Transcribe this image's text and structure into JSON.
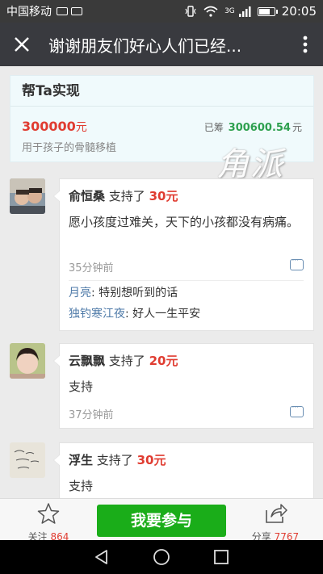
{
  "status": {
    "carrier": "中国移动",
    "network": "3G",
    "time": "20:05",
    "battery_level": 0.75
  },
  "header": {
    "title": "谢谢朋友们好心人们已经..."
  },
  "project": {
    "heading": "帮Ta实现",
    "target_amount": "300000",
    "target_unit": "元",
    "raised_label": "已筹",
    "raised_amount": "300600.54",
    "raised_unit": "元",
    "purpose": "用于孩子的骨髓移植"
  },
  "watermark": "角派",
  "feed": [
    {
      "name": "俞恒桑",
      "verb": "支持了",
      "amount": "30元",
      "message": "愿小孩度过难关，天下的小孩都没有病痛。",
      "time": "35分钟前",
      "replies": [
        {
          "name": "月亮",
          "text": "特别想听到的话"
        },
        {
          "name": "独钓寒江夜",
          "text": "好人一生平安"
        }
      ]
    },
    {
      "name": "云飘飘",
      "verb": "支持了",
      "amount": "20元",
      "message": "支持",
      "time": "37分钟前",
      "replies": []
    },
    {
      "name": "浮生",
      "verb": "支持了",
      "amount": "30元",
      "message": "支持",
      "time": "",
      "replies": []
    }
  ],
  "bottom": {
    "follow_label": "关注",
    "follow_count": "864",
    "join_label": "我要参与",
    "share_label": "分享",
    "share_count": "7767"
  },
  "colors": {
    "accent_red": "#e03c31",
    "green": "#1aad19",
    "header": "#393a3f"
  }
}
